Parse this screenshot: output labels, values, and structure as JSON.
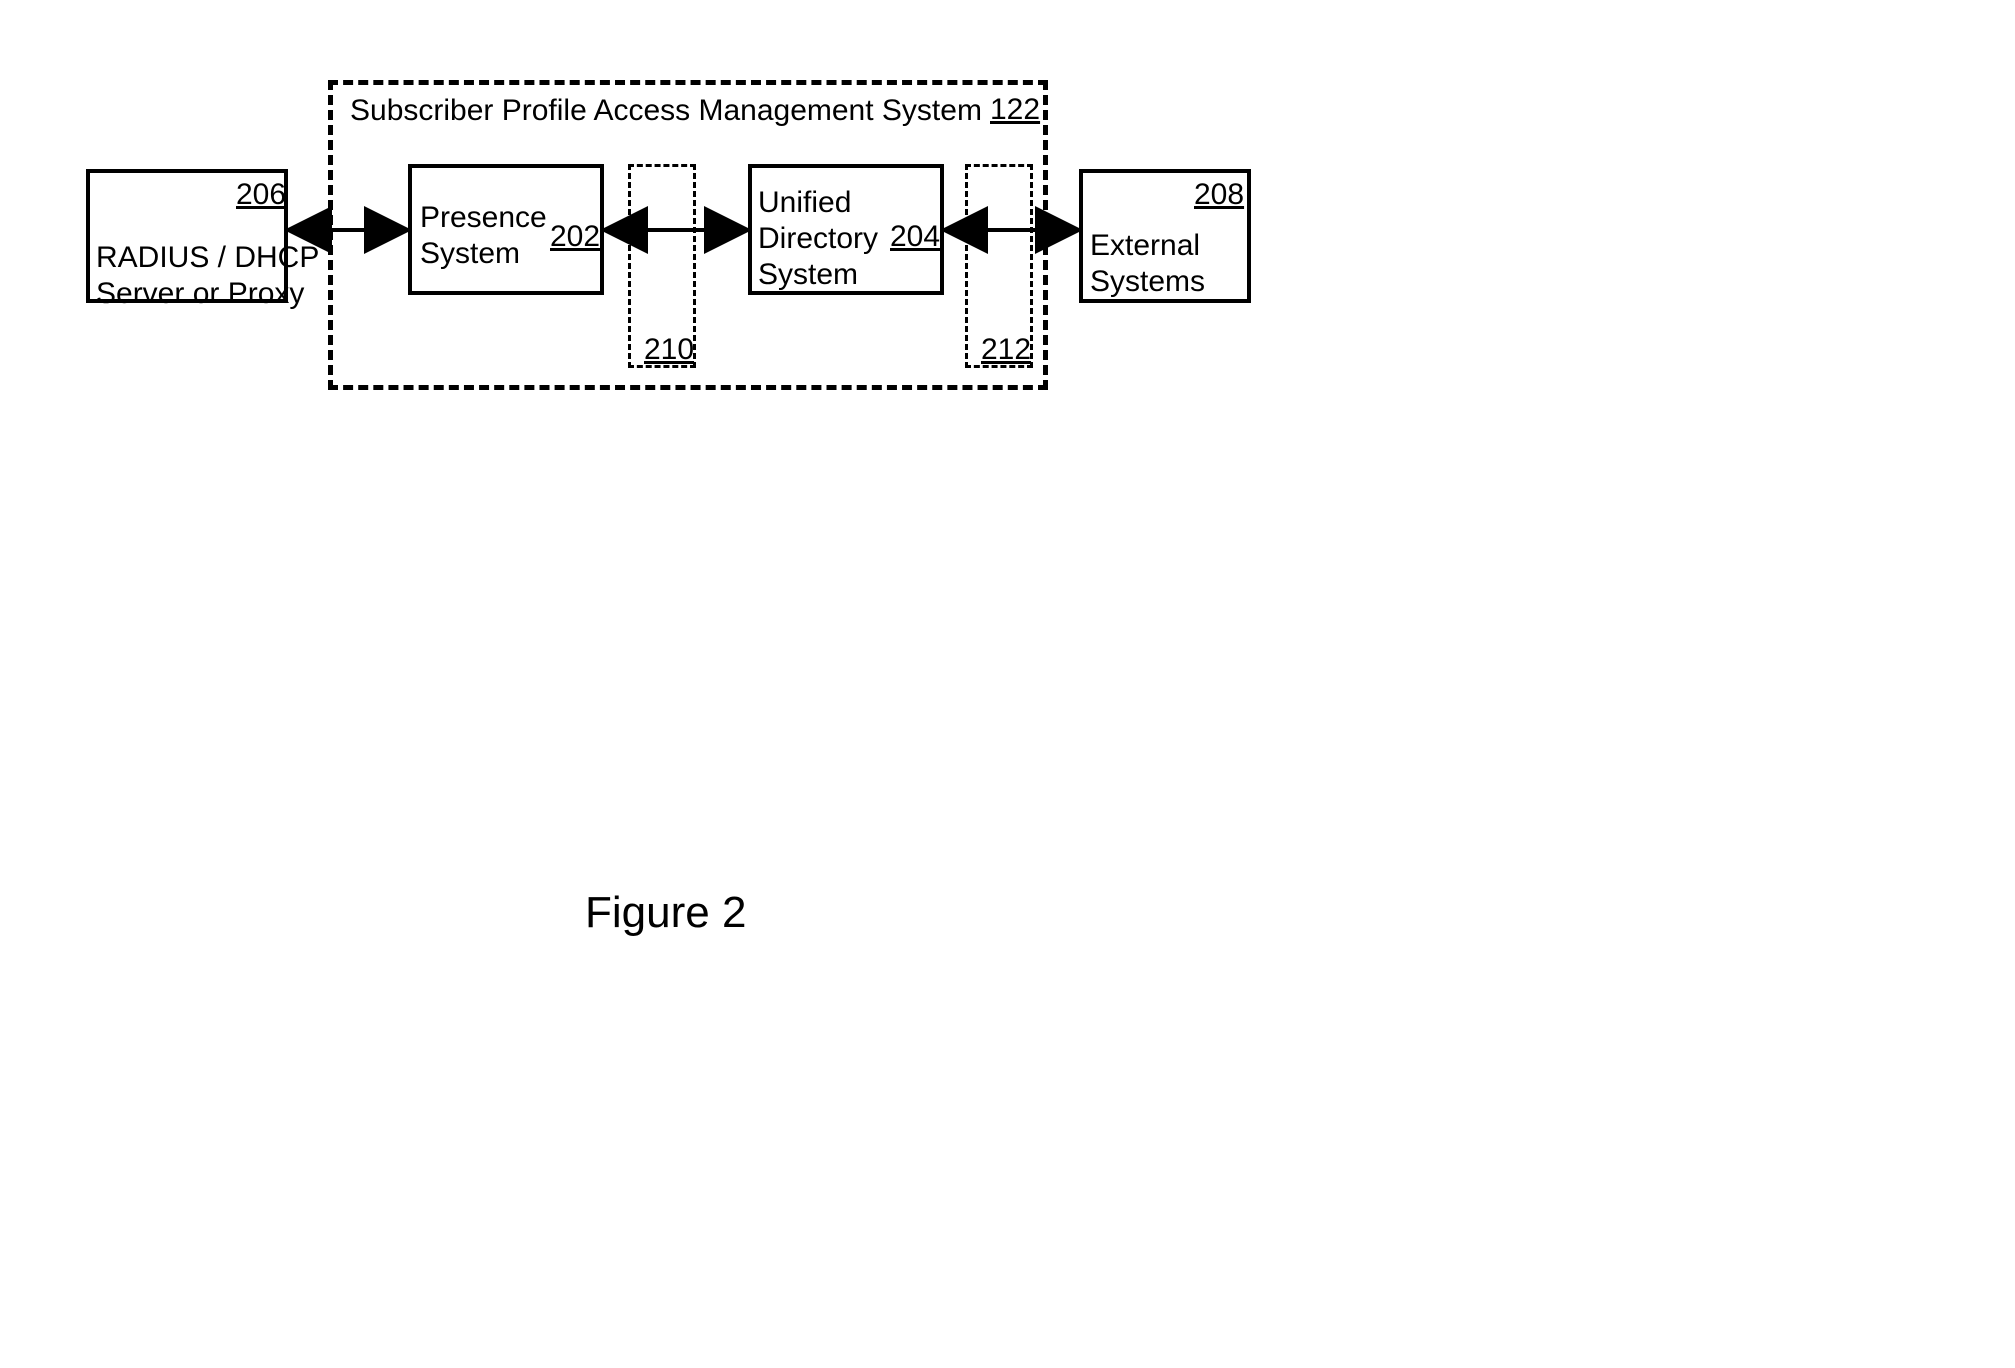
{
  "figure_title": "Figure 2",
  "outer": {
    "title": "Subscriber Profile Access Management System",
    "ref": "122"
  },
  "radius": {
    "label": "RADIUS / DHCP\nServer or Proxy",
    "ref": "206"
  },
  "presence": {
    "label": "Presence\nSystem",
    "ref": "202"
  },
  "uds": {
    "label": "Unified\nDirectory\nSystem",
    "ref": "204"
  },
  "external": {
    "label": "External\nSystems",
    "ref": "208"
  },
  "inter1": {
    "ref": "210"
  },
  "inter2": {
    "ref": "212"
  }
}
